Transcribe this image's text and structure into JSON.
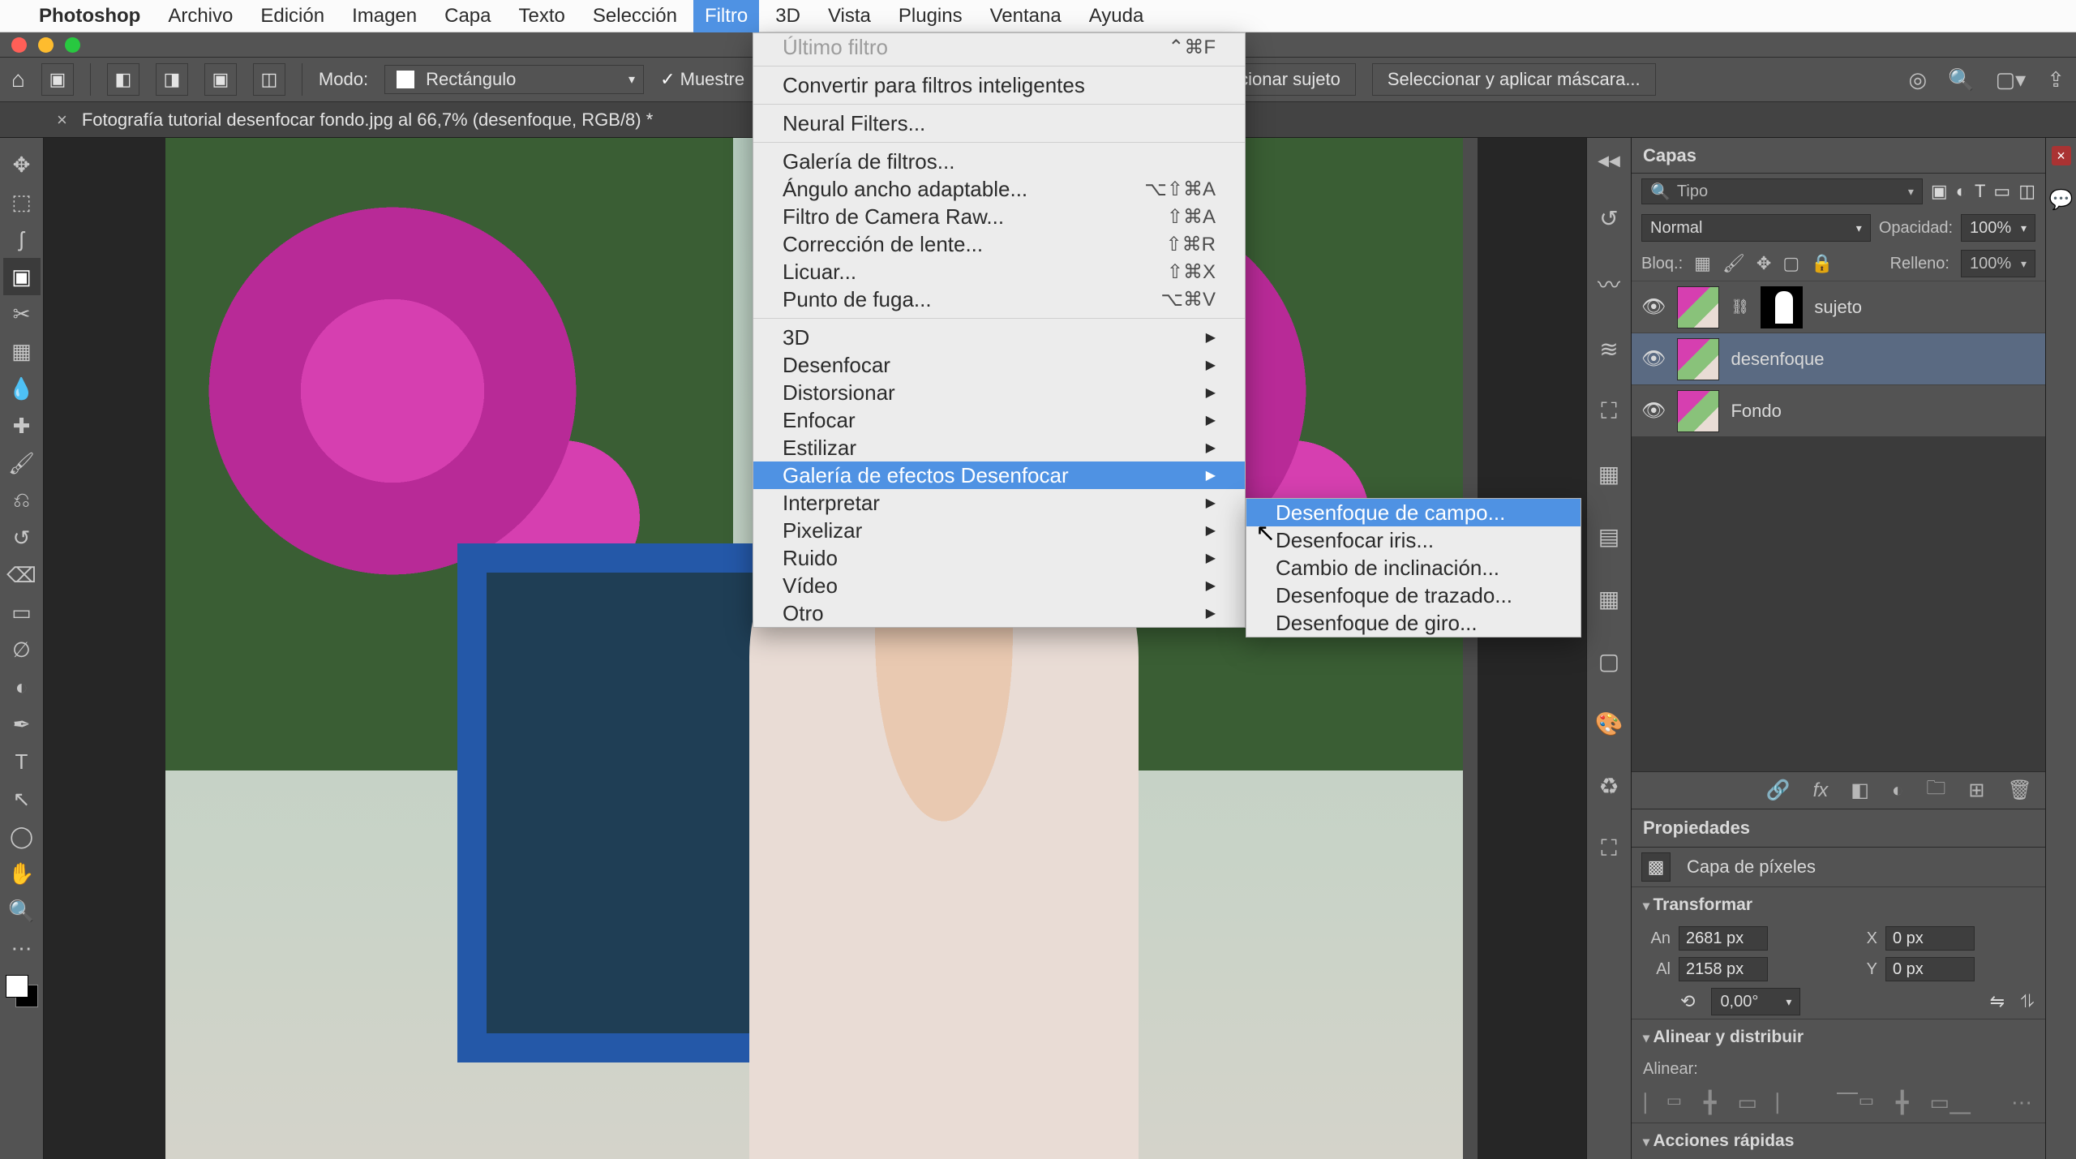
{
  "menubar": {
    "apple": "",
    "app": "Photoshop",
    "items": [
      "Archivo",
      "Edición",
      "Imagen",
      "Capa",
      "Texto",
      "Selección",
      "Filtro",
      "3D",
      "Vista",
      "Plugins",
      "Ventana",
      "Ayuda"
    ],
    "active_index": 6
  },
  "optionsbar": {
    "mode_label": "Modo:",
    "shape_select": "Rectángulo",
    "sample_checkbox": "Muestre",
    "btn_subject": "ccionar sujeto",
    "btn_mask": "Seleccionar y aplicar máscara..."
  },
  "doc_tab": {
    "label": "Fotografía tutorial desenfocar fondo.jpg al 66,7% (desenfoque, RGB/8) *"
  },
  "filter_menu": {
    "last": {
      "label": "Último filtro",
      "shortcut": "⌃⌘F",
      "disabled": true
    },
    "groups": [
      [
        {
          "label": "Convertir para filtros inteligentes"
        }
      ],
      [
        {
          "label": "Neural Filters..."
        }
      ],
      [
        {
          "label": "Galería de filtros..."
        },
        {
          "label": "Ángulo ancho adaptable...",
          "shortcut": "⌥⇧⌘A"
        },
        {
          "label": "Filtro de Camera Raw...",
          "shortcut": "⇧⌘A"
        },
        {
          "label": "Corrección de lente...",
          "shortcut": "⇧⌘R"
        },
        {
          "label": "Licuar...",
          "shortcut": "⇧⌘X"
        },
        {
          "label": "Punto de fuga...",
          "shortcut": "⌥⌘V"
        }
      ],
      [
        {
          "label": "3D",
          "sub": true
        },
        {
          "label": "Desenfocar",
          "sub": true
        },
        {
          "label": "Distorsionar",
          "sub": true
        },
        {
          "label": "Enfocar",
          "sub": true
        },
        {
          "label": "Estilizar",
          "sub": true
        },
        {
          "label": "Galería de efectos Desenfocar",
          "sub": true,
          "selected": true
        },
        {
          "label": "Interpretar",
          "sub": true
        },
        {
          "label": "Pixelizar",
          "sub": true
        },
        {
          "label": "Ruido",
          "sub": true
        },
        {
          "label": "Vídeo",
          "sub": true
        },
        {
          "label": "Otro",
          "sub": true
        }
      ]
    ]
  },
  "filter_submenu": [
    {
      "label": "Desenfoque de campo...",
      "selected": true
    },
    {
      "label": "Desenfocar iris..."
    },
    {
      "label": "Cambio de inclinación..."
    },
    {
      "label": "Desenfoque de trazado..."
    },
    {
      "label": "Desenfoque de giro..."
    }
  ],
  "layers_panel": {
    "title": "Capas",
    "search_placeholder": "Tipo",
    "blend_mode": "Normal",
    "opacity_label": "Opacidad:",
    "opacity_value": "100%",
    "lock_label": "Bloq.:",
    "fill_label": "Relleno:",
    "fill_value": "100%",
    "layers": [
      {
        "name": "sujeto",
        "has_mask": true,
        "selected": false
      },
      {
        "name": "desenfoque",
        "has_mask": false,
        "selected": true
      },
      {
        "name": "Fondo",
        "has_mask": false,
        "selected": false
      }
    ]
  },
  "properties_panel": {
    "title": "Propiedades",
    "kind": "Capa de píxeles",
    "transform": {
      "title": "Transformar",
      "w_label": "An",
      "w": "2681 px",
      "h_label": "Al",
      "h": "2158 px",
      "x_label": "X",
      "x": "0 px",
      "y_label": "Y",
      "y": "0 px",
      "angle": "0,00°"
    },
    "align": {
      "title": "Alinear y distribuir",
      "label": "Alinear:"
    },
    "quick": {
      "title": "Acciones rápidas"
    }
  },
  "tool_names": [
    "move",
    "marquee",
    "lasso",
    "object-select",
    "crop",
    "frame",
    "eyedropper",
    "healing",
    "brush",
    "clone",
    "history-brush",
    "eraser",
    "gradient",
    "blur",
    "dodge",
    "pen",
    "type",
    "path-select",
    "shape",
    "hand",
    "zoom",
    "edit-toolbar"
  ],
  "tool_glyphs": [
    "✥",
    "⬚",
    "ʃ",
    "▣",
    "✂",
    "▦",
    "💧",
    "✚",
    "🖌",
    "⎌",
    "↺",
    "⌫",
    "▭",
    "∅",
    "◐",
    "✒",
    "T",
    "↖",
    "◯",
    "✋",
    "🔍",
    "⋯"
  ],
  "dock_names": [
    "history",
    "brushes",
    "brush-settings",
    "adjustments",
    "styles",
    "grid-a",
    "grid-b",
    "swatch",
    "color",
    "libraries",
    "artboards"
  ],
  "dock_glyphs": [
    "↺",
    "〰",
    "≋",
    "⛶",
    "▦",
    "▤",
    "▦",
    "▢",
    "🎨",
    "♻",
    "⛶"
  ]
}
